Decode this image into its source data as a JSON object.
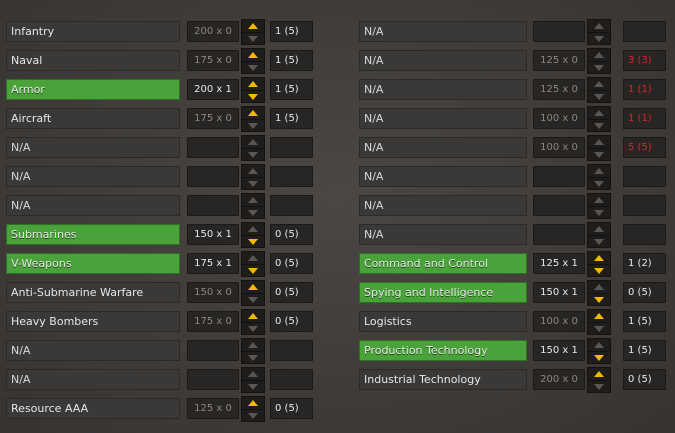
{
  "left": [
    {
      "id": "infantry",
      "name": "Infantry",
      "active": false,
      "cost": "200 x 0",
      "cost_active": false,
      "up": true,
      "down": false,
      "count": "1 (5)",
      "red": false
    },
    {
      "id": "naval",
      "name": "Naval",
      "active": false,
      "cost": "175 x 0",
      "cost_active": false,
      "up": true,
      "down": false,
      "count": "1 (5)",
      "red": false
    },
    {
      "id": "armor",
      "name": "Armor",
      "active": true,
      "cost": "200 x 1",
      "cost_active": true,
      "up": true,
      "down": true,
      "count": "1 (5)",
      "red": false
    },
    {
      "id": "aircraft",
      "name": "Aircraft",
      "active": false,
      "cost": "175 x 0",
      "cost_active": false,
      "up": true,
      "down": false,
      "count": "1 (5)",
      "red": false
    },
    {
      "id": "na-1",
      "name": "N/A",
      "active": false,
      "cost": "",
      "cost_active": false,
      "up": false,
      "down": false,
      "count": "",
      "red": false
    },
    {
      "id": "na-2",
      "name": "N/A",
      "active": false,
      "cost": "",
      "cost_active": false,
      "up": false,
      "down": false,
      "count": "",
      "red": false
    },
    {
      "id": "na-3",
      "name": "N/A",
      "active": false,
      "cost": "",
      "cost_active": false,
      "up": false,
      "down": false,
      "count": "",
      "red": false
    },
    {
      "id": "submarines",
      "name": "Submarines",
      "active": true,
      "cost": "150 x 1",
      "cost_active": true,
      "up": false,
      "down": true,
      "count": "0 (5)",
      "red": false
    },
    {
      "id": "v-weapons",
      "name": "V-Weapons",
      "active": true,
      "cost": "175 x 1",
      "cost_active": true,
      "up": false,
      "down": true,
      "count": "0 (5)",
      "red": false
    },
    {
      "id": "anti-submarine-warfare",
      "name": "Anti-Submarine Warfare",
      "active": false,
      "cost": "150 x 0",
      "cost_active": false,
      "up": true,
      "down": false,
      "count": "0 (5)",
      "red": false
    },
    {
      "id": "heavy-bombers",
      "name": "Heavy Bombers",
      "active": false,
      "cost": "175 x 0",
      "cost_active": false,
      "up": true,
      "down": false,
      "count": "0 (5)",
      "red": false
    },
    {
      "id": "na-4",
      "name": "N/A",
      "active": false,
      "cost": "",
      "cost_active": false,
      "up": false,
      "down": false,
      "count": "",
      "red": false
    },
    {
      "id": "na-5",
      "name": "N/A",
      "active": false,
      "cost": "",
      "cost_active": false,
      "up": false,
      "down": false,
      "count": "",
      "red": false
    },
    {
      "id": "resource-aaa",
      "name": "Resource AAA",
      "active": false,
      "cost": "125 x 0",
      "cost_active": false,
      "up": true,
      "down": false,
      "count": "0 (5)",
      "red": false
    }
  ],
  "right": [
    {
      "id": "na-r1",
      "name": "N/A",
      "active": false,
      "cost": "",
      "cost_active": false,
      "up": false,
      "down": false,
      "count": "",
      "red": false
    },
    {
      "id": "na-r2",
      "name": "N/A",
      "active": false,
      "cost": "125 x 0",
      "cost_active": false,
      "up": false,
      "down": false,
      "count": "3 (3)",
      "red": true
    },
    {
      "id": "na-r3",
      "name": "N/A",
      "active": false,
      "cost": "125 x 0",
      "cost_active": false,
      "up": false,
      "down": false,
      "count": "1 (1)",
      "red": true
    },
    {
      "id": "na-r4",
      "name": "N/A",
      "active": false,
      "cost": "100 x 0",
      "cost_active": false,
      "up": false,
      "down": false,
      "count": "1 (1)",
      "red": true
    },
    {
      "id": "na-r5",
      "name": "N/A",
      "active": false,
      "cost": "100 x 0",
      "cost_active": false,
      "up": false,
      "down": false,
      "count": "5 (5)",
      "red": true
    },
    {
      "id": "na-r6",
      "name": "N/A",
      "active": false,
      "cost": "",
      "cost_active": false,
      "up": false,
      "down": false,
      "count": "",
      "red": false
    },
    {
      "id": "na-r7",
      "name": "N/A",
      "active": false,
      "cost": "",
      "cost_active": false,
      "up": false,
      "down": false,
      "count": "",
      "red": false
    },
    {
      "id": "na-r8",
      "name": "N/A",
      "active": false,
      "cost": "",
      "cost_active": false,
      "up": false,
      "down": false,
      "count": "",
      "red": false
    },
    {
      "id": "command-and-control",
      "name": "Command and Control",
      "active": true,
      "cost": "125 x 1",
      "cost_active": true,
      "up": true,
      "down": true,
      "count": "1 (2)",
      "red": false
    },
    {
      "id": "spying-and-intelligence",
      "name": "Spying and Intelligence",
      "active": true,
      "cost": "150 x 1",
      "cost_active": true,
      "up": false,
      "down": true,
      "count": "0 (5)",
      "red": false
    },
    {
      "id": "logistics",
      "name": "Logistics",
      "active": false,
      "cost": "100 x 0",
      "cost_active": false,
      "up": true,
      "down": false,
      "count": "1 (5)",
      "red": false
    },
    {
      "id": "production-technology",
      "name": "Production Technology",
      "active": true,
      "cost": "150 x 1",
      "cost_active": true,
      "up": false,
      "down": true,
      "count": "1 (5)",
      "red": false
    },
    {
      "id": "industrial-technology",
      "name": "Industrial Technology",
      "active": false,
      "cost": "200 x 0",
      "cost_active": false,
      "up": true,
      "down": false,
      "count": "0 (5)",
      "red": false
    }
  ]
}
